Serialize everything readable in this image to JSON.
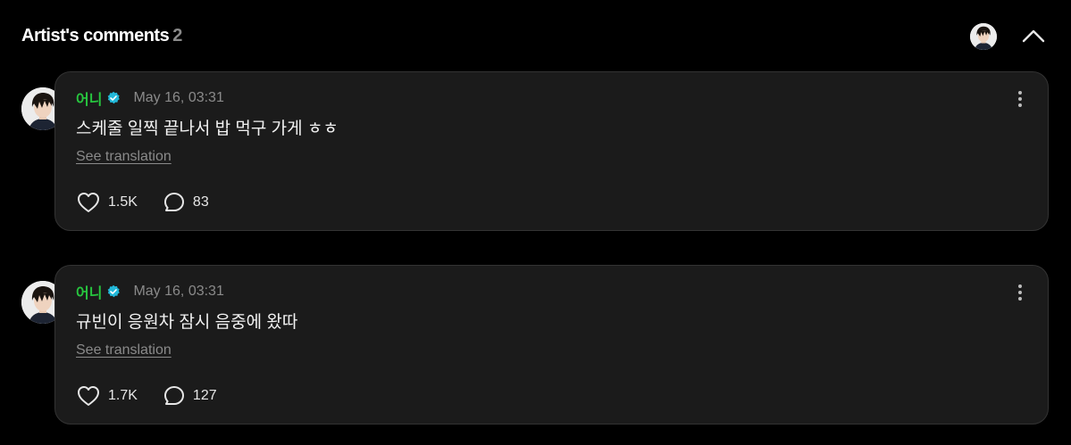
{
  "header": {
    "title": "Artist's comments",
    "count": "2"
  },
  "comments": [
    {
      "author": "어니",
      "date": "May 16, 03:31",
      "text": "스케줄 일찍 끝나서 밥 먹구 가게 ㅎㅎ",
      "translate_label": "See translation",
      "likes": "1.5K",
      "replies": "83"
    },
    {
      "author": "어니",
      "date": "May 16, 03:31",
      "text": "규빈이 응원차 잠시 음중에 왔따",
      "translate_label": "See translation",
      "likes": "1.7K",
      "replies": "127"
    }
  ],
  "icons": {
    "header_avatar": "avatar-image",
    "collapse": "chevron-up-icon",
    "verified": "verified-badge-icon",
    "like": "heart-icon",
    "reply": "speech-bubble-icon",
    "more": "kebab-menu-icon"
  },
  "colors": {
    "background": "#000000",
    "card": "#1b1b1b",
    "author": "#27c63f",
    "verified": "#22b8d9",
    "muted": "#8a8a8a"
  }
}
